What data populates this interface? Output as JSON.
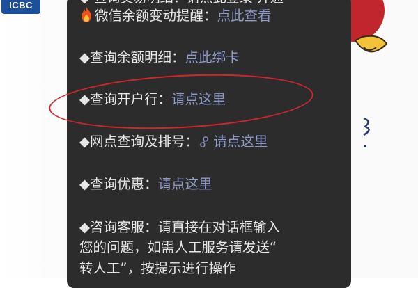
{
  "logo": {
    "text": "ICBC"
  },
  "menu": {
    "top_cut_text": "◆ 查询交易明细：请点此登录 开通",
    "items": [
      {
        "prefix": "微信余额变动提醒：",
        "link": "点此查看",
        "icon": "fire-icon"
      },
      {
        "prefix": "◆查询余额明细：",
        "link": "点此绑卡"
      },
      {
        "prefix": "◆查询开户行：",
        "link": "请点这里",
        "highlighted": true
      },
      {
        "prefix": "◆网点查询及排号：",
        "link": "请点这里",
        "icon": "link-icon",
        "icon_glyph": "🔗︎"
      },
      {
        "prefix": "◆查询优惠：",
        "link": "请点这里"
      }
    ],
    "service": {
      "line1": "◆咨询客服：请直接在对话框输入",
      "line2": "您的问题，如需人工服务请发送“",
      "line3": "转人工”，按提示进行操作"
    }
  },
  "colors": {
    "panel_bg": "#2c2c2c",
    "text": "#e6e6e6",
    "link": "#8f9bc9",
    "highlight_oval": "#d3262c"
  }
}
